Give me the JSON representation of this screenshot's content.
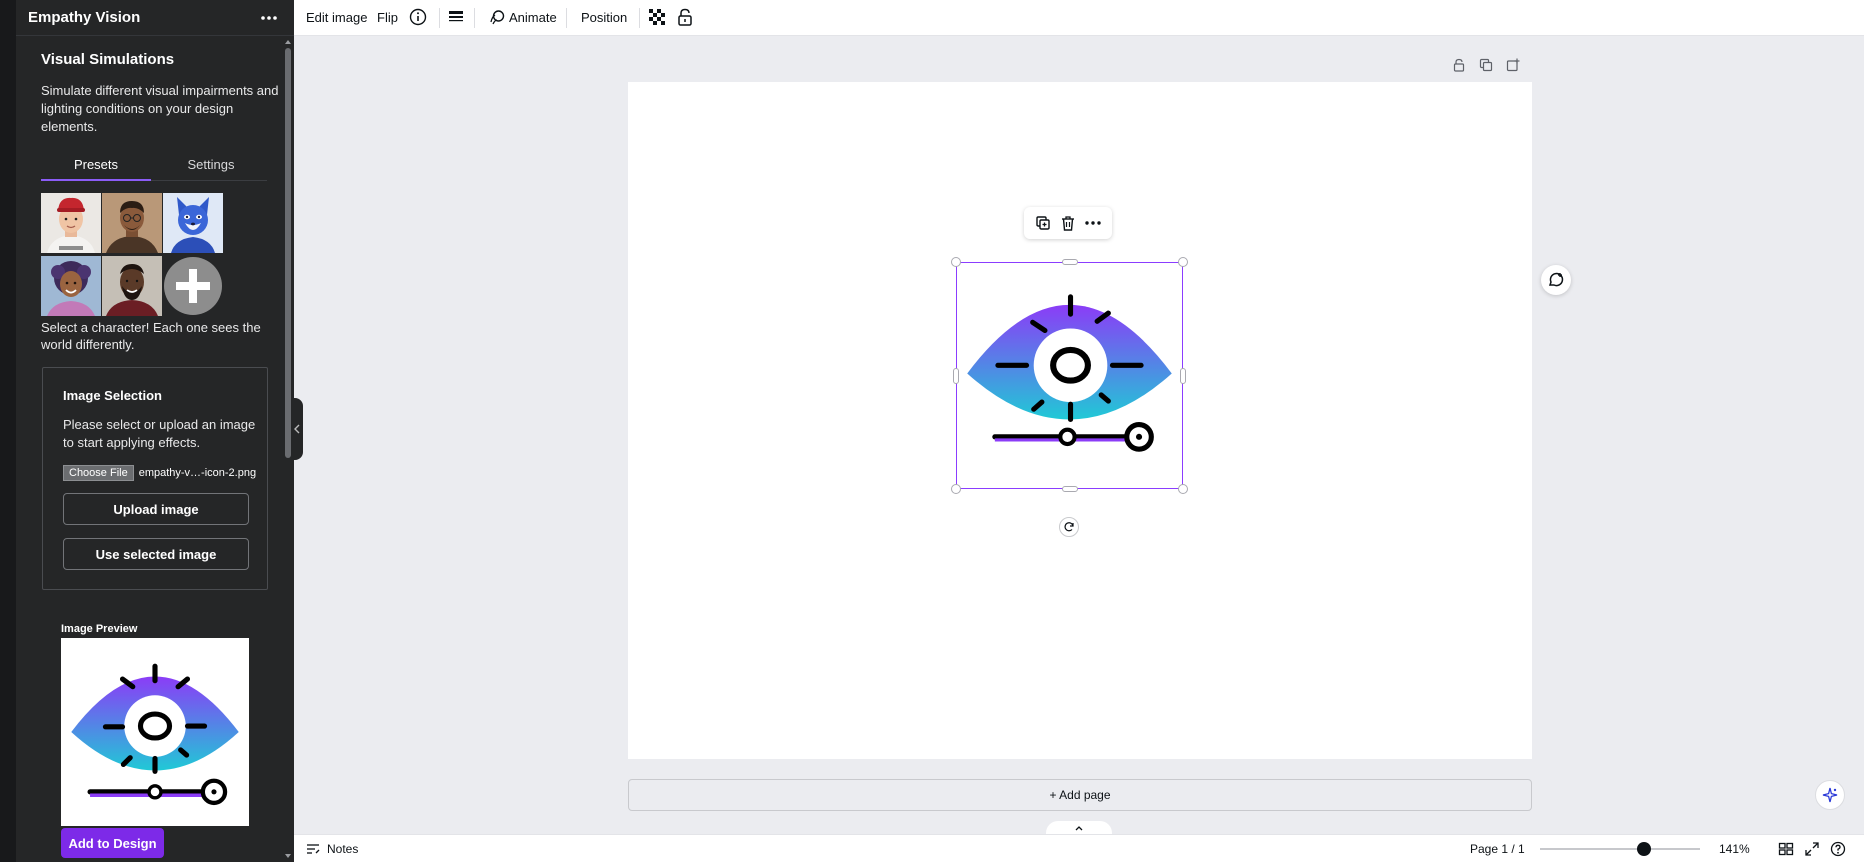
{
  "sidebar": {
    "app_title": "Empathy Vision",
    "section_title": "Visual Simulations",
    "section_description": "Simulate different visual impairments and lighting conditions on your design elements.",
    "tabs": [
      {
        "label": "Presets",
        "active": true
      },
      {
        "label": "Settings",
        "active": false
      }
    ],
    "characters": [
      "character-1",
      "character-2",
      "character-3",
      "character-4",
      "character-5",
      "add-character"
    ],
    "select_hint": "Select a character! Each one sees the world differently.",
    "image_selection": {
      "title": "Image Selection",
      "description": "Please select or upload an image to start applying effects.",
      "choose_file_label": "Choose File",
      "file_name": "empathy-v…-icon-2.png",
      "upload_label": "Upload image",
      "use_selected_label": "Use selected image"
    },
    "preview_label": "Image Preview",
    "add_to_design_label": "Add to Design"
  },
  "toolbar": {
    "edit_image": "Edit image",
    "flip": "Flip",
    "animate": "Animate",
    "position": "Position"
  },
  "canvas": {
    "add_page_label": "+ Add page"
  },
  "bottombar": {
    "notes_label": "Notes",
    "page_indicator": "Page 1 / 1",
    "zoom": "141%",
    "zoom_level_fraction": 0.65
  },
  "colors": {
    "accent": "#7d2ae8",
    "selection": "#8b3dff",
    "eye_top": "#8b3cf7",
    "eye_bottom": "#20c9d6",
    "panel_bg": "#252627"
  },
  "icons": [
    "more-horizontal-icon",
    "info-icon",
    "line-weight-icon",
    "animate-icon",
    "transparency-icon",
    "lock-icon",
    "copy-icon",
    "trash-icon",
    "rotate-icon",
    "comment-icon",
    "notes-icon",
    "grid-view-icon",
    "fullscreen-icon",
    "help-icon",
    "magic-assistant-icon",
    "chevron-left-icon",
    "chevron-up-icon"
  ]
}
